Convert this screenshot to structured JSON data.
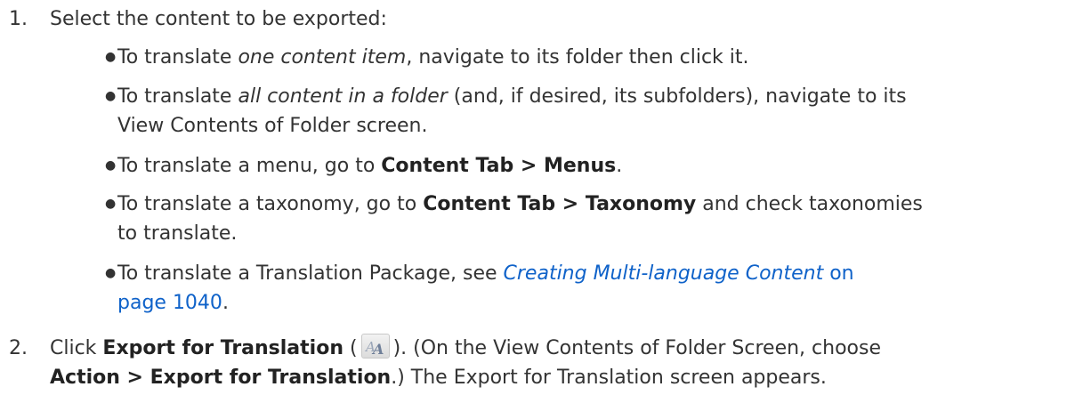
{
  "step1": {
    "number": "1.",
    "intro": "Select the content to be exported:",
    "bullets": [
      {
        "pre": "To translate ",
        "em": "one content item",
        "post": ", navigate to its folder then click it."
      },
      {
        "pre": "To translate ",
        "em": "all content in a folder",
        "post_line1": " (and, if desired, its subfolders), navigate to its",
        "line2": "View Contents of Folder screen."
      },
      {
        "pre": "To translate a menu, go to ",
        "bold": "Content Tab > Menus",
        "post": "."
      },
      {
        "pre": "To translate a taxonomy, go to ",
        "bold": "Content Tab > Taxonomy",
        "post_line1": " and check taxonomies",
        "line2": "to translate."
      },
      {
        "pre": "To translate a Translation Package, see ",
        "link_em": "Creating Multi-language Content",
        "link_on": " on",
        "link_page": "page 1040",
        "post": "."
      }
    ]
  },
  "step2": {
    "number": "2.",
    "pre": "Click ",
    "bold1": "Export for Translation",
    "paren_open": " (",
    "icon": "export-for-translation-icon",
    "paren_close": "). (On the View Contents of Folder Screen, choose",
    "bold2": "Action > Export for Translation",
    "post": ".) The Export for Translation screen appears."
  }
}
